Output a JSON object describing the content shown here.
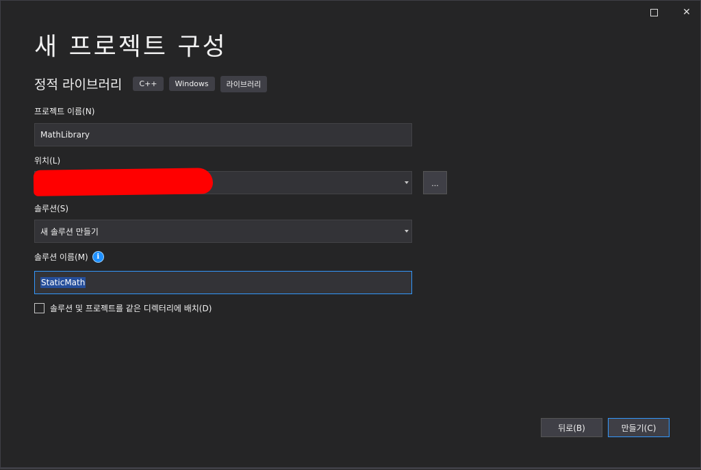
{
  "window": {
    "maximize_label": "",
    "close_label": "✕"
  },
  "page": {
    "title": "새 프로젝트 구성",
    "subtitle": "정적 라이브러리",
    "tags": [
      "C++",
      "Windows",
      "라이브러리"
    ]
  },
  "form": {
    "project_name_label": "프로젝트 이름(N)",
    "project_name_value": "MathLibrary",
    "location_label": "위치(L)",
    "location_value": "",
    "browse_label": "...",
    "solution_label": "솔루션(S)",
    "solution_value": "새 솔루션 만들기",
    "solution_name_label": "솔루션 이름(M)",
    "solution_name_value": "StaticMath",
    "info_glyph": "i",
    "same_dir_label": "솔루션 및 프로젝트를 같은 디렉터리에 배치(D)",
    "same_dir_checked": false
  },
  "footer": {
    "back_label": "뒤로(B)",
    "create_label": "만들기(C)"
  },
  "colors": {
    "background": "#252526",
    "field": "#333337",
    "accent": "#3399ff",
    "redaction": "#ff0000"
  }
}
